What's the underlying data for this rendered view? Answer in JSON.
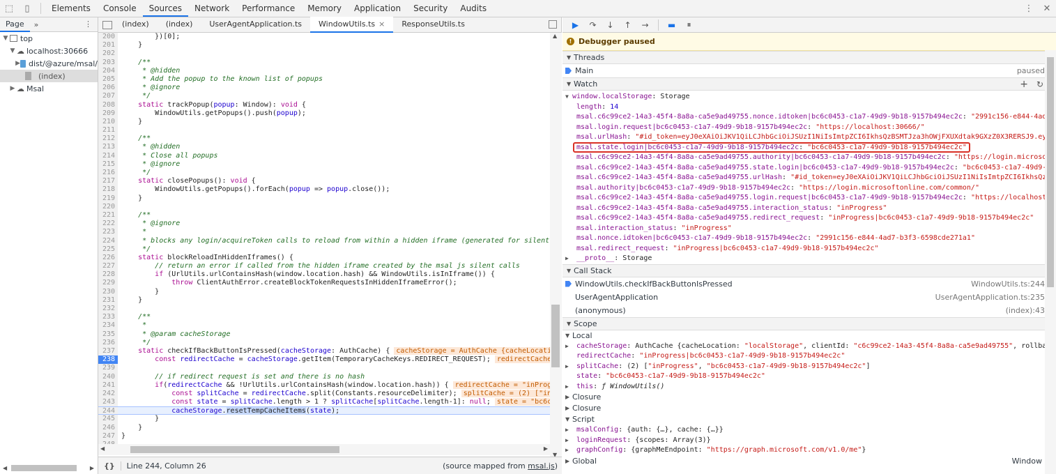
{
  "toolbar": {
    "tabs": [
      "Elements",
      "Console",
      "Sources",
      "Network",
      "Performance",
      "Memory",
      "Application",
      "Security",
      "Audits"
    ],
    "active_tab": "Sources"
  },
  "navigator": {
    "tab": "Page",
    "more": "»",
    "tree": [
      {
        "label": "top"
      },
      {
        "label": "localhost:30666"
      },
      {
        "label": "dist/@azure/msal/"
      },
      {
        "label": "(index)"
      },
      {
        "label": "Msal"
      }
    ]
  },
  "editor": {
    "tabs": [
      "(index)",
      "(index)",
      "UserAgentApplication.ts",
      "WindowUtils.ts",
      "ResponseUtils.ts"
    ],
    "active_tab": "WindowUtils.ts",
    "status_position": "Line 244, Column 26",
    "status_source_prefix": "(source mapped from ",
    "status_source_link": "msal.js",
    "status_source_suffix": ")",
    "lines": [
      {
        "n": "200",
        "html": "        })[0];"
      },
      {
        "n": "201",
        "html": "    }"
      },
      {
        "n": "202",
        "html": ""
      },
      {
        "n": "203",
        "html": "    <span class=\"cm\">/**</span>"
      },
      {
        "n": "204",
        "html": "    <span class=\"cm\"> * @hidden</span>"
      },
      {
        "n": "205",
        "html": "    <span class=\"cm\"> * Add the popup to the known list of popups</span>"
      },
      {
        "n": "206",
        "html": "    <span class=\"cm\"> * @ignore</span>"
      },
      {
        "n": "207",
        "html": "    <span class=\"cm\"> */</span>"
      },
      {
        "n": "208",
        "html": "    <span class=\"kw\">static</span> trackPopup(<span class=\"pm\">popup</span>: Window): <span class=\"kw\">void</span> {"
      },
      {
        "n": "209",
        "html": "        WindowUtils.getPopups().push(<span class=\"pm\">popup</span>);"
      },
      {
        "n": "210",
        "html": "    }"
      },
      {
        "n": "211",
        "html": ""
      },
      {
        "n": "212",
        "html": "    <span class=\"cm\">/**</span>"
      },
      {
        "n": "213",
        "html": "    <span class=\"cm\"> * @hidden</span>"
      },
      {
        "n": "214",
        "html": "    <span class=\"cm\"> * Close all popups</span>"
      },
      {
        "n": "215",
        "html": "    <span class=\"cm\"> * @ignore</span>"
      },
      {
        "n": "216",
        "html": "    <span class=\"cm\"> */</span>"
      },
      {
        "n": "217",
        "html": "    <span class=\"kw\">static</span> closePopups(): <span class=\"kw\">void</span> {"
      },
      {
        "n": "218",
        "html": "        WindowUtils.getPopups().forEach(<span class=\"pm\">popup</span> => <span class=\"pm\">popup</span>.close());"
      },
      {
        "n": "219",
        "html": "    }"
      },
      {
        "n": "220",
        "html": ""
      },
      {
        "n": "221",
        "html": "    <span class=\"cm\">/**</span>"
      },
      {
        "n": "222",
        "html": "    <span class=\"cm\"> * @ignore</span>"
      },
      {
        "n": "223",
        "html": "    <span class=\"cm\"> *</span>"
      },
      {
        "n": "224",
        "html": "    <span class=\"cm\"> * blocks any login/acquireToken calls to reload from within a hidden iframe (generated for silent c</span>"
      },
      {
        "n": "225",
        "html": "    <span class=\"cm\"> */</span>"
      },
      {
        "n": "226",
        "html": "    <span class=\"kw\">static</span> blockReloadInHiddenIframes() {"
      },
      {
        "n": "227",
        "html": "        <span class=\"cm\">// return an error if called from the hidden iframe created by the msal js silent calls</span>"
      },
      {
        "n": "228",
        "html": "        <span class=\"kw\">if</span> (UrlUtils.urlContainsHash(window.location.hash) &amp;&amp; WindowUtils.isInIframe()) {"
      },
      {
        "n": "229",
        "html": "            <span class=\"kw\">throw</span> ClientAuthError.createBlockTokenRequestsInHiddenIframeError();"
      },
      {
        "n": "230",
        "html": "        }"
      },
      {
        "n": "231",
        "html": "    }"
      },
      {
        "n": "232",
        "html": ""
      },
      {
        "n": "233",
        "html": "    <span class=\"cm\">/**</span>"
      },
      {
        "n": "234",
        "html": "    <span class=\"cm\"> *</span>"
      },
      {
        "n": "235",
        "html": "    <span class=\"cm\"> * @param cacheStorage</span>"
      },
      {
        "n": "236",
        "html": "    <span class=\"cm\"> */</span>"
      },
      {
        "n": "237",
        "html": "    <span class=\"kw\">static</span> checkIfBackButtonIsPressed(<span class=\"pm\">cacheStorage</span>: AuthCache) {<span class=\"inl\">cacheStorage = AuthCache {cacheLocatio</span>"
      },
      {
        "n": "238",
        "html": "        <span class=\"kw\">const</span> <span class=\"pm\">redirectCache</span> = <span class=\"pm\">cacheStorage</span>.getItem(TemporaryCacheKeys.REDIRECT_REQUEST);<span class=\"inl\">redirectCache</span>",
        "bp": true
      },
      {
        "n": "239",
        "html": ""
      },
      {
        "n": "240",
        "html": "        <span class=\"cm\">// if redirect request is set and there is no hash</span>"
      },
      {
        "n": "241",
        "html": "        <span class=\"kw\">if</span>(<span class=\"pm\">redirectCache</span> &amp;&amp; !UrlUtils.urlContainsHash(window.location.hash)) {<span class=\"inl\">redirectCache = \"inProgr</span>"
      },
      {
        "n": "242",
        "html": "            <span class=\"kw\">const</span> <span class=\"pm\">splitCache</span> = <span class=\"pm\">redirectCache</span>.split(Constants.resourceDelimiter);<span class=\"inl\">splitCache = (2) [\"inP</span>"
      },
      {
        "n": "243",
        "html": "            <span class=\"kw\">const</span> <span class=\"pm\">state</span> = <span class=\"pm\">splitCache</span>.length > 1 ? <span class=\"pm\">splitCache</span>[<span class=\"pm\">splitCache</span>.length-1]: <span class=\"kw\">null</span>;<span class=\"inl\">state = \"bc6c0</span>"
      },
      {
        "n": "244",
        "html": "            <span class=\"pm\">cacheStorage</span>.<span style=\"background:#c6d8fa\">resetTempCacheItems</span>(<span class=\"pm\">state</span>);",
        "cur": true
      },
      {
        "n": "245",
        "html": "        }"
      },
      {
        "n": "246",
        "html": "    }"
      },
      {
        "n": "247",
        "html": "}"
      },
      {
        "n": "248",
        "html": ""
      }
    ]
  },
  "debugger": {
    "paused_label": "Debugger paused",
    "threads_header": "Threads",
    "thread_name": "Main",
    "thread_status": "paused",
    "watch_header": "Watch",
    "watch": [
      {
        "html": "<span class=\"wtri\">▼</span><span class=\"k\">window.localStorage</span><span class=\"d\">: Storage</span>",
        "indent": 0
      },
      {
        "html": "<span class=\"k\">length</span><span class=\"d\">: </span><span class=\"n\">14</span>",
        "indent": 1
      },
      {
        "html": "<span class=\"k\">msal.c6c99ce2-14a3-45f4-8a8a-ca5e9ad49755.nonce.idtoken|bc6c0453-c1a7-49d9-9b18-9157b494ec2c</span><span class=\"d\">: </span><span class=\"s\">\"2991c156-e844-4ad…</span>",
        "indent": 1
      },
      {
        "html": "<span class=\"k\">msal.login.request|bc6c0453-c1a7-49d9-9b18-9157b494ec2c</span><span class=\"d\">: </span><span class=\"s\">\"https://localhost:30666/\"</span>",
        "indent": 1
      },
      {
        "html": "<span class=\"k\">msal.urlHash</span><span class=\"d\">: </span><span class=\"s\">\"#id_token=eyJ0eXAiOiJKV1QiLCJhbGciOiJSUzI1NiIsImtpZCI6IkhsQzBSMTJza3hOWjFXUXdtak9GXzZ0X3RERSJ9.ey…</span>",
        "indent": 1
      },
      {
        "html": "<span class=\"hl\"><span class=\"k\">msal.state.login|bc6c0453-c1a7-49d9-9b18-9157b494ec2c</span><span class=\"d\">: </span><span class=\"s\">\"bc6c0453-c1a7-49d9-9b18-9157b494ec2c\"</span></span>",
        "indent": 1
      },
      {
        "html": "<span class=\"k\">msal.c6c99ce2-14a3-45f4-8a8a-ca5e9ad49755.authority|bc6c0453-c1a7-49d9-9b18-9157b494ec2c</span><span class=\"d\">: </span><span class=\"s\">\"https://login.microso…</span>",
        "indent": 1
      },
      {
        "html": "<span class=\"k\">msal.c6c99ce2-14a3-45f4-8a8a-ca5e9ad49755.state.login|bc6c0453-c1a7-49d9-9b18-9157b494ec2c</span><span class=\"d\">: </span><span class=\"s\">\"bc6c0453-c1a7-49d9-…</span>",
        "indent": 1
      },
      {
        "html": "<span class=\"k\">msal.c6c99ce2-14a3-45f4-8a8a-ca5e9ad49755.urlHash</span><span class=\"d\">: </span><span class=\"s\">\"#id_token=eyJ0eXAiOiJKV1QiLCJhbGciOiJSUzI1NiIsImtpZCI6IkhsQz…</span>",
        "indent": 1
      },
      {
        "html": "<span class=\"k\">msal.authority|bc6c0453-c1a7-49d9-9b18-9157b494ec2c</span><span class=\"d\">: </span><span class=\"s\">\"https://login.microsoftonline.com/common/\"</span>",
        "indent": 1
      },
      {
        "html": "<span class=\"k\">msal.c6c99ce2-14a3-45f4-8a8a-ca5e9ad49755.login.request|bc6c0453-c1a7-49d9-9b18-9157b494ec2c</span><span class=\"d\">: </span><span class=\"s\">\"https://localhost…</span>",
        "indent": 1
      },
      {
        "html": "<span class=\"k\">msal.c6c99ce2-14a3-45f4-8a8a-ca5e9ad49755.interaction_status</span><span class=\"d\">: </span><span class=\"s\">\"inProgress\"</span>",
        "indent": 1
      },
      {
        "html": "<span class=\"k\">msal.c6c99ce2-14a3-45f4-8a8a-ca5e9ad49755.redirect_request</span><span class=\"d\">: </span><span class=\"s\">\"inProgress|bc6c0453-c1a7-49d9-9b18-9157b494ec2c\"</span>",
        "indent": 1
      },
      {
        "html": "<span class=\"k\">msal.interaction_status</span><span class=\"d\">: </span><span class=\"s\">\"inProgress\"</span>",
        "indent": 1
      },
      {
        "html": "<span class=\"k\">msal.nonce.idtoken|bc6c0453-c1a7-49d9-9b18-9157b494ec2c</span><span class=\"d\">: </span><span class=\"s\">\"2991c156-e844-4ad7-b3f3-6598cde271a1\"</span>",
        "indent": 1
      },
      {
        "html": "<span class=\"k\">msal.redirect_request</span><span class=\"d\">: </span><span class=\"s\">\"inProgress|bc6c0453-c1a7-49d9-9b18-9157b494ec2c\"</span>",
        "indent": 1
      },
      {
        "html": "<span class=\"wtri\">▶</span><span class=\"k\">__proto__</span><span class=\"d\">: Storage</span>",
        "indent": 1
      }
    ],
    "callstack_header": "Call Stack",
    "callstack": [
      {
        "fn": "WindowUtils.checkIfBackButtonIsPressed",
        "loc": "WindowUtils.ts:244",
        "current": true
      },
      {
        "fn": "UserAgentApplication",
        "loc": "UserAgentApplication.ts:235"
      },
      {
        "fn": "(anonymous)",
        "loc": "(index):43"
      }
    ],
    "scope_header": "Scope",
    "scope_local": "Local",
    "scope": [
      {
        "html": "<span class=\"wtri\">▶</span><span class=\"k\">cacheStorage</span><span class=\"d\">: AuthCache {cacheLocation: </span><span class=\"s\">\"localStorage\"</span><span class=\"d\">, clientId: </span><span class=\"s\">\"c6c99ce2-14a3-45f4-8a8a-ca5e9ad49755\"</span><span class=\"d\">, rollba…</span>"
      },
      {
        "html": "<span class=\"k\">redirectCache</span><span class=\"d\">: </span><span class=\"s\">\"inProgress|bc6c0453-c1a7-49d9-9b18-9157b494ec2c\"</span>"
      },
      {
        "html": "<span class=\"wtri\">▶</span><span class=\"k\">splitCache</span><span class=\"d\">: (2) [</span><span class=\"s\">\"inProgress\"</span><span class=\"d\">, </span><span class=\"s\">\"bc6c0453-c1a7-49d9-9b18-9157b494ec2c\"</span><span class=\"d\">]</span>"
      },
      {
        "html": "<span class=\"k\">state</span><span class=\"d\">: </span><span class=\"s\">\"bc6c0453-c1a7-49d9-9b18-9157b494ec2c\"</span>"
      },
      {
        "html": "<span class=\"wtri\">▶</span><span class=\"k\">this</span><span class=\"d\">: <i>ƒ WindowUtils()</i></span>"
      }
    ],
    "closure1": "Closure",
    "closure2": "Closure",
    "script_header": "Script",
    "script": [
      {
        "html": "<span class=\"wtri\">▶</span><span class=\"k\">msalConfig</span><span class=\"d\">: {auth: {…}, cache: {…}}</span>"
      },
      {
        "html": "<span class=\"wtri\">▶</span><span class=\"k\">loginRequest</span><span class=\"d\">: {scopes: Array(3)}</span>"
      },
      {
        "html": "<span class=\"wtri\">▶</span><span class=\"k\">graphConfig</span><span class=\"d\">: {graphMeEndpoint: </span><span class=\"s\">\"https://graph.microsoft.com/v1.0/me\"</span><span class=\"d\">}</span>"
      }
    ],
    "global_label": "Global",
    "global_value": "Window"
  }
}
